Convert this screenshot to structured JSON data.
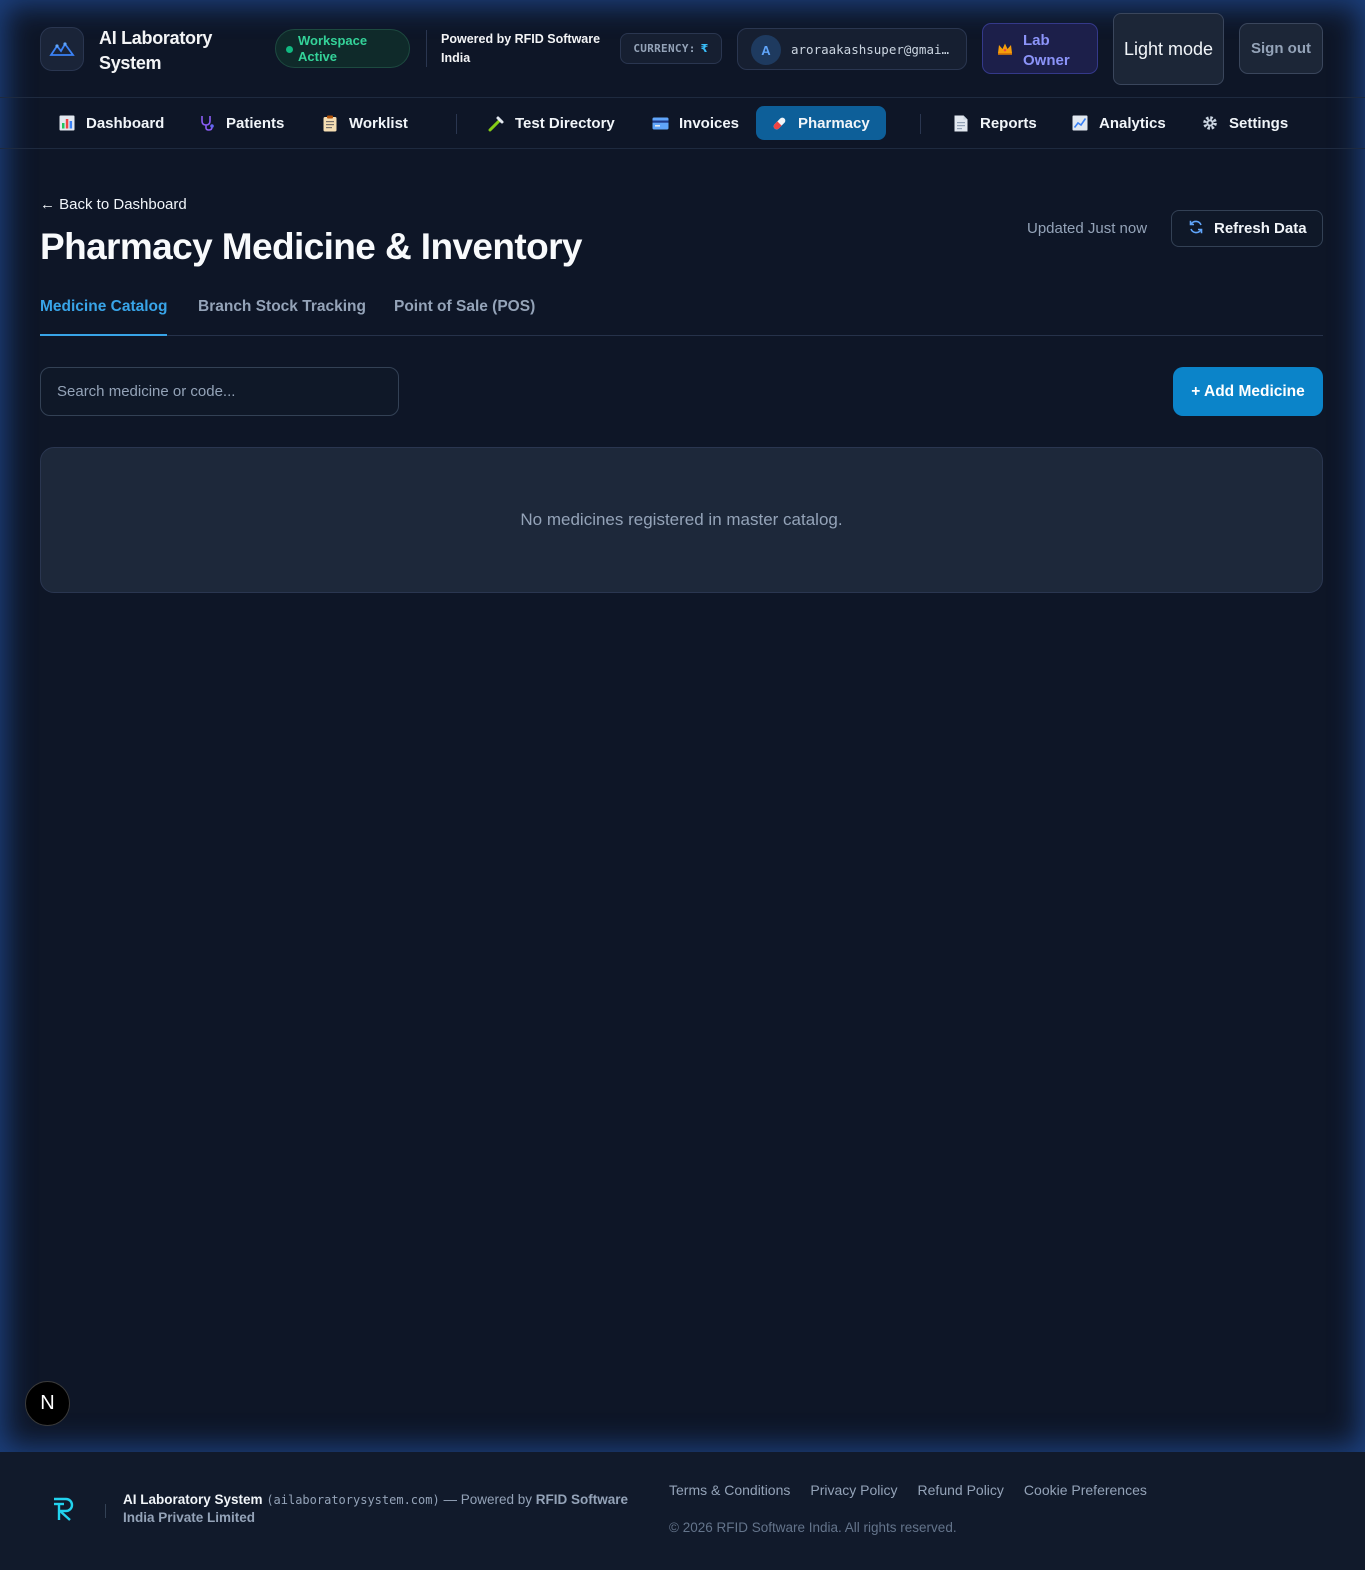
{
  "header": {
    "app_title": "AI Laboratory System",
    "workspace_badge": "Workspace Active",
    "powered_by": "Powered by RFID Software India",
    "currency_label": "CURRENCY:",
    "currency_symbol": "₹",
    "user_initial": "A",
    "user_email": "aroraakashsuper@gmai…",
    "role_label": "Lab Owner",
    "theme_toggle": "Light mode",
    "sign_out": "Sign out"
  },
  "nav": {
    "items": [
      {
        "label": "Dashboard",
        "icon": "bar-chart-icon"
      },
      {
        "label": "Patients",
        "icon": "stethoscope-icon"
      },
      {
        "label": "Worklist",
        "icon": "clipboard-icon"
      },
      {
        "label": "Test Directory",
        "icon": "pipette-icon"
      },
      {
        "label": "Invoices",
        "icon": "credit-card-icon"
      },
      {
        "label": "Pharmacy",
        "icon": "pill-icon",
        "active": true
      },
      {
        "label": "Reports",
        "icon": "document-icon"
      },
      {
        "label": "Analytics",
        "icon": "line-chart-icon"
      },
      {
        "label": "Settings",
        "icon": "gear-icon"
      }
    ]
  },
  "page": {
    "back_link": "← Back to Dashboard",
    "title": "Pharmacy Medicine & Inventory",
    "updated": "Updated Just now",
    "refresh": "Refresh Data",
    "tabs": [
      {
        "label": "Medicine Catalog",
        "active": true
      },
      {
        "label": "Branch Stock Tracking"
      },
      {
        "label": "Point of Sale (POS)"
      }
    ],
    "search_placeholder": "Search medicine or code...",
    "add_button": "+ Add Medicine",
    "empty_message": "No medicines registered in master catalog."
  },
  "floating_badge": "N",
  "footer": {
    "brand": "AI Laboratory System",
    "domain": "(ailaboratorysystem.com)",
    "powered_prefix": "— Powered by",
    "company": "RFID Software India Private Limited",
    "links": [
      "Terms & Conditions",
      "Privacy Policy",
      "Refund Policy",
      "Cookie Preferences"
    ],
    "copyright": "© 2026 RFID Software India. All rights reserved."
  },
  "colors": {
    "background": "#0e1627",
    "accent": "#0b84c9",
    "active_nav": "#0d5f99",
    "active_tab": "#38a4e8",
    "status_green": "#34d399"
  }
}
